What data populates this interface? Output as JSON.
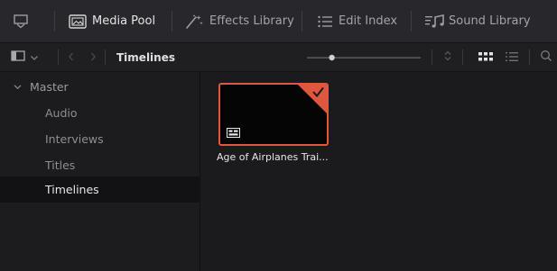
{
  "tabs": [
    {
      "label": "Media Pool",
      "icon": "media-pool-icon",
      "active": true
    },
    {
      "label": "Effects Library",
      "icon": "effects-wand-icon",
      "active": false
    },
    {
      "label": "Edit Index",
      "icon": "edit-index-list-icon",
      "active": false
    },
    {
      "label": "Sound Library",
      "icon": "sound-library-icon",
      "active": false
    }
  ],
  "toolbar": {
    "breadcrumb": "Timelines",
    "zoom_slider_value": 0.2
  },
  "sidebar": {
    "master_label": "Master",
    "bins": [
      "Audio",
      "Interviews",
      "Titles",
      "Timelines"
    ],
    "selected": "Timelines"
  },
  "clips": [
    {
      "name": "Age of Airplanes Trai...",
      "type": "timeline",
      "selected": true
    }
  ],
  "colors": {
    "accent": "#e0573f",
    "background": "#1b1b1e",
    "panel": "#28282c"
  }
}
